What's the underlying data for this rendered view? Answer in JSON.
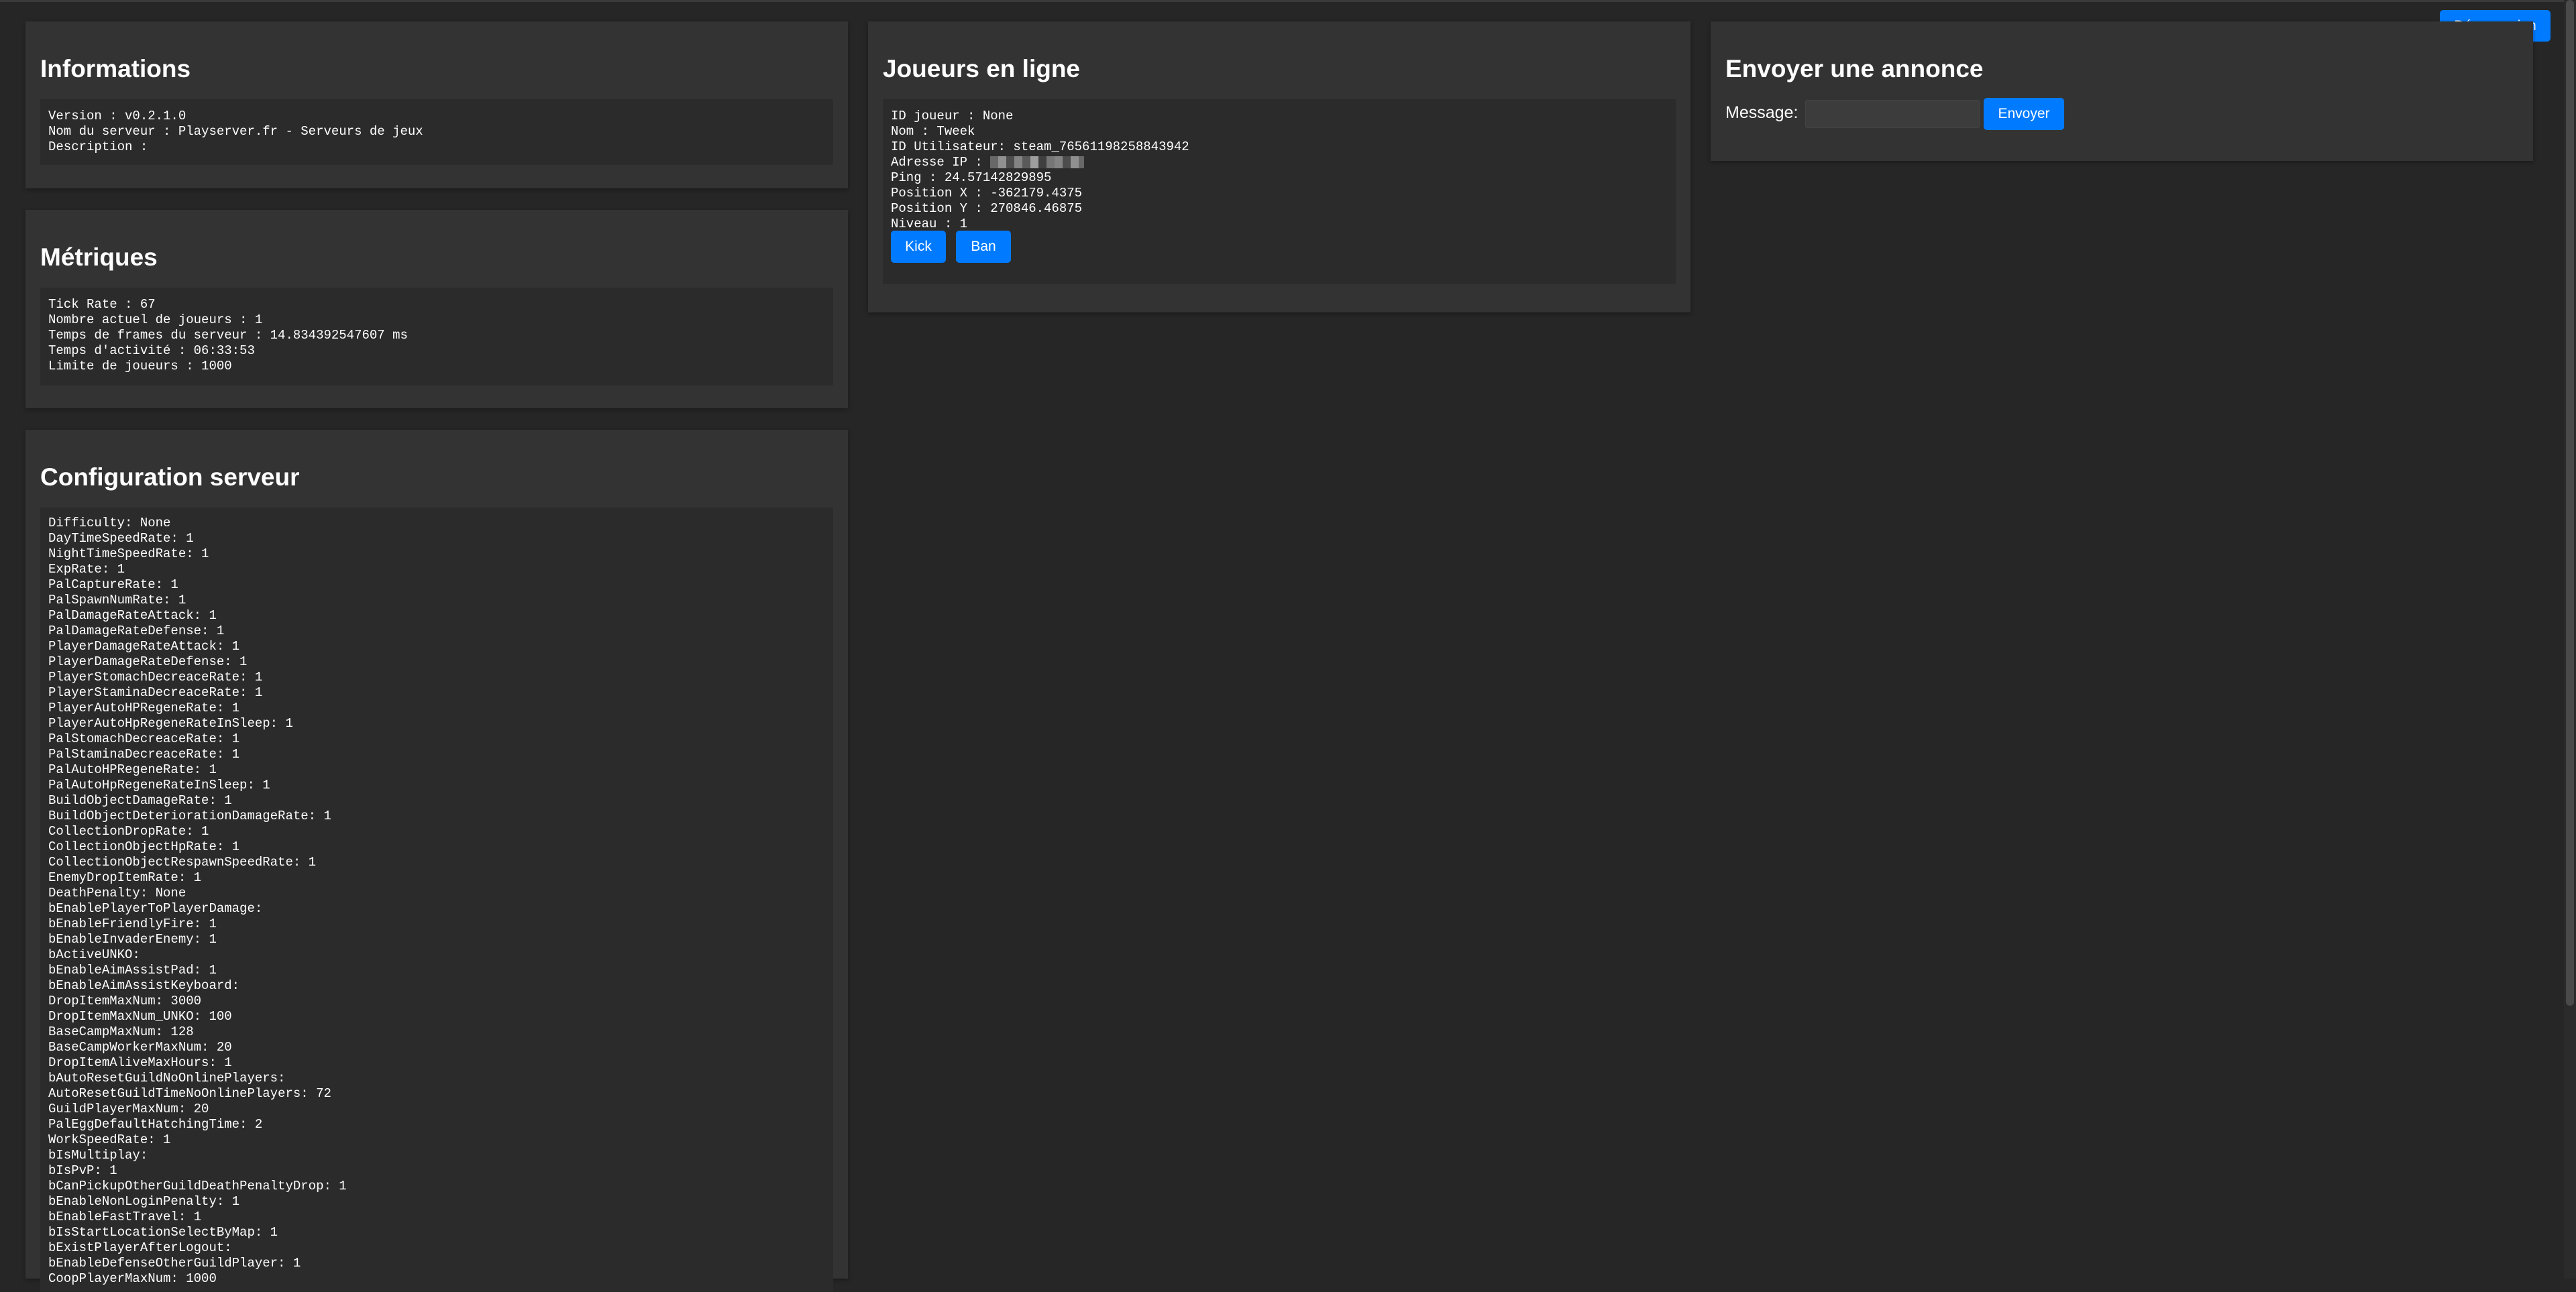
{
  "header": {
    "logout_label": "Déconnexion"
  },
  "informations": {
    "title": "Informations",
    "lines": [
      "Version : v0.2.1.0",
      "Nom du serveur : Playserver.fr - Serveurs de jeux",
      "Description :"
    ]
  },
  "metriques": {
    "title": "Métriques",
    "lines": [
      "Tick Rate : 67",
      "Nombre actuel de joueurs : 1",
      "Temps de frames du serveur : 14.834392547607 ms",
      "Temps d'activité : 06:33:53",
      "Limite de joueurs : 1000"
    ]
  },
  "config": {
    "title": "Configuration serveur",
    "lines": [
      "Difficulty: None",
      "DayTimeSpeedRate: 1",
      "NightTimeSpeedRate: 1",
      "ExpRate: 1",
      "PalCaptureRate: 1",
      "PalSpawnNumRate: 1",
      "PalDamageRateAttack: 1",
      "PalDamageRateDefense: 1",
      "PlayerDamageRateAttack: 1",
      "PlayerDamageRateDefense: 1",
      "PlayerStomachDecreaceRate: 1",
      "PlayerStaminaDecreaceRate: 1",
      "PlayerAutoHPRegeneRate: 1",
      "PlayerAutoHpRegeneRateInSleep: 1",
      "PalStomachDecreaceRate: 1",
      "PalStaminaDecreaceRate: 1",
      "PalAutoHPRegeneRate: 1",
      "PalAutoHpRegeneRateInSleep: 1",
      "BuildObjectDamageRate: 1",
      "BuildObjectDeteriorationDamageRate: 1",
      "CollectionDropRate: 1",
      "CollectionObjectHpRate: 1",
      "CollectionObjectRespawnSpeedRate: 1",
      "EnemyDropItemRate: 1",
      "DeathPenalty: None",
      "bEnablePlayerToPlayerDamage:",
      "bEnableFriendlyFire: 1",
      "bEnableInvaderEnemy: 1",
      "bActiveUNKO:",
      "bEnableAimAssistPad: 1",
      "bEnableAimAssistKeyboard:",
      "DropItemMaxNum: 3000",
      "DropItemMaxNum_UNKO: 100",
      "BaseCampMaxNum: 128",
      "BaseCampWorkerMaxNum: 20",
      "DropItemAliveMaxHours: 1",
      "bAutoResetGuildNoOnlinePlayers:",
      "AutoResetGuildTimeNoOnlinePlayers: 72",
      "GuildPlayerMaxNum: 20",
      "PalEggDefaultHatchingTime: 2",
      "WorkSpeedRate: 1",
      "bIsMultiplay:",
      "bIsPvP: 1",
      "bCanPickupOtherGuildDeathPenaltyDrop: 1",
      "bEnableNonLoginPenalty: 1",
      "bEnableFastTravel: 1",
      "bIsStartLocationSelectByMap: 1",
      "bExistPlayerAfterLogout:",
      "bEnableDefenseOtherGuildPlayer: 1",
      "CoopPlayerMaxNum: 1000"
    ]
  },
  "players": {
    "title": "Joueurs en ligne",
    "player": {
      "id_line": "ID joueur : None",
      "name_line": "Nom : Tweek",
      "user_id_line": "ID Utilisateur: steam_76561198258843942",
      "ip_label": "Adresse IP : ",
      "ping_line": "Ping : 24.57142829895",
      "pos_x_line": "Position X : -362179.4375",
      "pos_y_line": "Position Y : 270846.46875",
      "level_line": "Niveau : 1"
    },
    "kick_label": "Kick",
    "ban_label": "Ban"
  },
  "announce": {
    "title": "Envoyer une annonce",
    "message_label": "Message:",
    "message_value": "",
    "send_label": "Envoyer"
  }
}
